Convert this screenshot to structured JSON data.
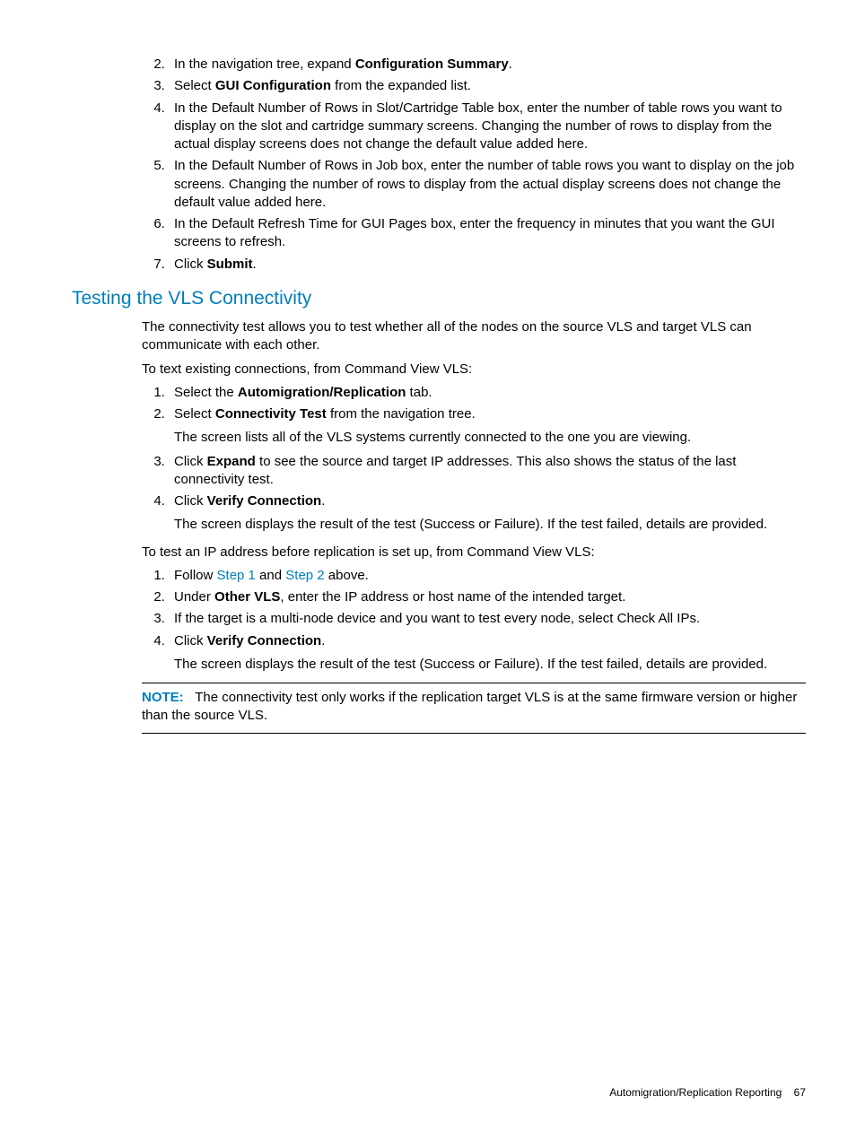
{
  "list1": {
    "start": 2,
    "items": [
      {
        "pre": "In the navigation tree, expand ",
        "bold": "Configuration Summary",
        "post": "."
      },
      {
        "pre": "Select ",
        "bold": "GUI Configuration",
        "post": " from the expanded list."
      },
      {
        "text": "In the Default Number of Rows in Slot/Cartridge Table box, enter the number of table rows you want to display on the slot and cartridge summary screens. Changing the number of rows to display from the actual display screens does not change the default value added here."
      },
      {
        "text": "In the Default Number of Rows in Job box, enter the number of table rows you want to display on the job screens. Changing the number of rows to display from the actual display screens does not change the default value added here."
      },
      {
        "text": "In the Default Refresh Time for GUI Pages box, enter the frequency in minutes that you want the GUI screens to refresh."
      },
      {
        "pre": "Click ",
        "bold": "Submit",
        "post": "."
      }
    ]
  },
  "heading": "Testing the VLS Connectivity",
  "intro1": "The connectivity test allows you to test whether all of the nodes on the source VLS and target VLS can communicate with each other.",
  "intro2": "To text existing connections, from Command View VLS:",
  "list2": [
    {
      "pre": "Select the ",
      "bold": "Automigration/Replication",
      "post": " tab."
    },
    {
      "pre": "Select ",
      "bold": "Connectivity Test",
      "post": " from the navigation tree.",
      "sub": "The screen lists all of the VLS systems currently connected to the one you are viewing."
    },
    {
      "pre": "Click ",
      "bold": "Expand",
      "post": " to see the source and target IP addresses. This also shows the status of the last connectivity test."
    },
    {
      "pre": "Click ",
      "bold": "Verify Connection",
      "post": ".",
      "sub": "The screen displays the result of the test (Success or Failure). If the test failed, details are provided."
    }
  ],
  "intro3": "To test an IP address before replication is set up, from Command View VLS:",
  "list3": {
    "item1_pre": "Follow ",
    "item1_link1": "Step 1",
    "item1_mid": " and ",
    "item1_link2": "Step 2",
    "item1_post": " above.",
    "item2_pre": "Under ",
    "item2_bold": "Other VLS",
    "item2_post": ", enter the IP address or host name of the intended target.",
    "item3": "If the target is a multi-node device and you want to test every node, select Check All IPs.",
    "item4_pre": "Click ",
    "item4_bold": "Verify Connection",
    "item4_post": ".",
    "item4_sub": "The screen displays the result of the test (Success or Failure). If the test failed, details are provided."
  },
  "note_label": "NOTE:",
  "note_text": "The connectivity test only works if the replication target VLS is at the same firmware version or higher than the source VLS.",
  "footer_text": "Automigration/Replication Reporting",
  "footer_page": "67"
}
